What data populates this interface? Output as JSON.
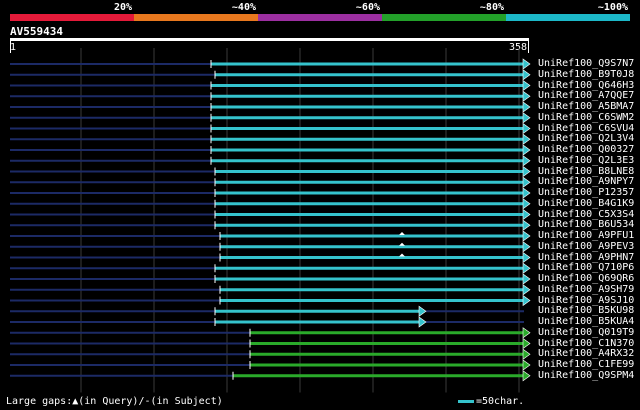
{
  "legend": {
    "colors": [
      "#e41a39",
      "#e8781e",
      "#9c2fa1",
      "#23a12a",
      "#1cb8c8"
    ],
    "labels": [
      "20%",
      "~40%",
      "~60%",
      "~80%",
      "~100%"
    ]
  },
  "query": {
    "id": "AV559434",
    "start": "1",
    "end": "358"
  },
  "hits": [
    {
      "label": "UniRef100_Q9S7N7",
      "start": 211,
      "color": "cyan"
    },
    {
      "label": "UniRef100_B9T0J8",
      "start": 215,
      "color": "cyan"
    },
    {
      "label": "UniRef100_Q646H3",
      "start": 211,
      "color": "cyan"
    },
    {
      "label": "UniRef100_A7QQE7",
      "start": 211,
      "color": "cyan"
    },
    {
      "label": "UniRef100_A5BMA7",
      "start": 211,
      "color": "cyan"
    },
    {
      "label": "UniRef100_C6SWM2",
      "start": 211,
      "color": "cyan"
    },
    {
      "label": "UniRef100_C6SVU4",
      "start": 211,
      "color": "cyan"
    },
    {
      "label": "UniRef100_Q2L3V4",
      "start": 211,
      "color": "cyan"
    },
    {
      "label": "UniRef100_Q00327",
      "start": 211,
      "color": "cyan"
    },
    {
      "label": "UniRef100_Q2L3E3",
      "start": 211,
      "color": "cyan"
    },
    {
      "label": "UniRef100_B8LNE8",
      "start": 215,
      "color": "cyan"
    },
    {
      "label": "UniRef100_A9NPY7",
      "start": 215,
      "color": "cyan"
    },
    {
      "label": "UniRef100_P12357",
      "start": 215,
      "color": "cyan"
    },
    {
      "label": "UniRef100_B4G1K9",
      "start": 215,
      "color": "cyan"
    },
    {
      "label": "UniRef100_C5X3S4",
      "start": 215,
      "color": "cyan"
    },
    {
      "label": "UniRef100_B6U534",
      "start": 215,
      "color": "cyan"
    },
    {
      "label": "UniRef100_A9PFU1",
      "start": 220,
      "color": "cyan",
      "gap": true
    },
    {
      "label": "UniRef100_A9PEV3",
      "start": 220,
      "color": "cyan",
      "gap": true
    },
    {
      "label": "UniRef100_A9PHN7",
      "start": 220,
      "color": "cyan",
      "gap": true
    },
    {
      "label": "UniRef100_Q710P6",
      "start": 215,
      "color": "cyan"
    },
    {
      "label": "UniRef100_Q69QR6",
      "start": 215,
      "color": "cyan"
    },
    {
      "label": "UniRef100_A9SH79",
      "start": 220,
      "color": "cyan"
    },
    {
      "label": "UniRef100_A9SJ10",
      "start": 220,
      "color": "cyan"
    },
    {
      "label": "UniRef100_B5KU98",
      "start": 215,
      "color": "cyan",
      "end": 420
    },
    {
      "label": "UniRef100_B5KUA4",
      "start": 215,
      "color": "cyan",
      "end": 420
    },
    {
      "label": "UniRef100_Q019T9",
      "start": 250,
      "color": "green"
    },
    {
      "label": "UniRef100_C1N370",
      "start": 250,
      "color": "green"
    },
    {
      "label": "UniRef100_A4RX32",
      "start": 250,
      "color": "green"
    },
    {
      "label": "UniRef100_C1FE99",
      "start": 250,
      "color": "green"
    },
    {
      "label": "UniRef100_Q9SPM4",
      "start": 233,
      "color": "green"
    }
  ],
  "footer": {
    "gaps_text": "Large gaps:▲(in Query)/-(in Subject)",
    "scale_text": "=50char."
  }
}
